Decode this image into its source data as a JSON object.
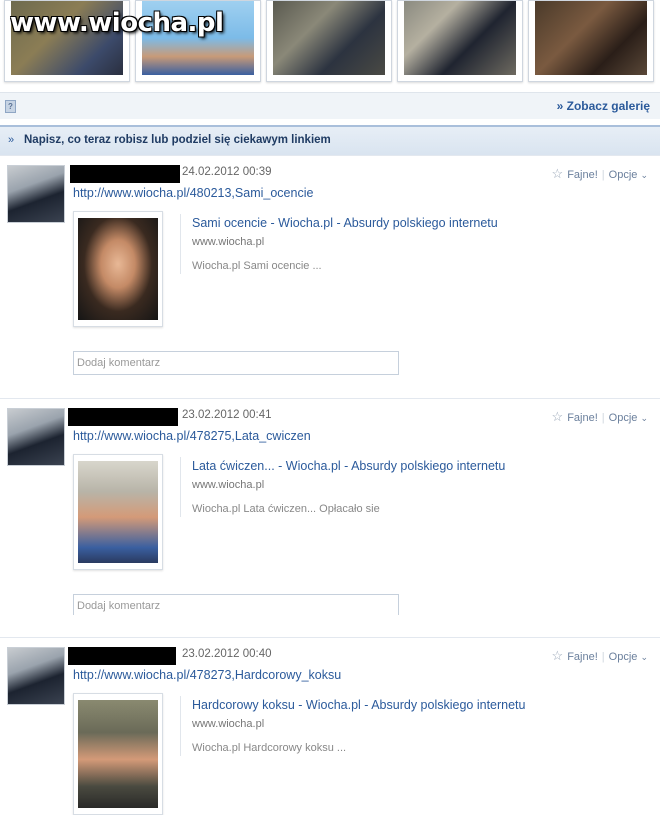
{
  "watermark": "www.wiocha.pl",
  "gallery": {
    "icon": "gallery-icon",
    "link_label": "» Zobacz galerię"
  },
  "status_prompt": {
    "arrow": "»",
    "text": "Napisz, co teraz robisz lub podziel się ciekawym linkiem"
  },
  "actions": {
    "like": "Fajne!",
    "options": "Opcje",
    "star_icon": "☆",
    "chevron_icon": "⌄"
  },
  "posts": [
    {
      "date": "24.02.2012 00:39",
      "url": "http://www.wiocha.pl/480213,Sami_ocencie",
      "link_title": "Sami ocencie - Wiocha.pl - Absurdy polskiego internetu",
      "link_domain": "www.wiocha.pl",
      "link_desc": "Wiocha.pl Sami ocencie ...",
      "comment_placeholder": "Dodaj komentarz"
    },
    {
      "date": "23.02.2012 00:41",
      "url": "http://www.wiocha.pl/478275,Lata_cwiczen",
      "link_title": "Lata ćwiczen... - Wiocha.pl - Absurdy polskiego internetu",
      "link_domain": "www.wiocha.pl",
      "link_desc": "Wiocha.pl Lata ćwiczen... Opłacało sie",
      "comment_placeholder": "Dodaj komentarz"
    },
    {
      "date": "23.02.2012 00:40",
      "url": "http://www.wiocha.pl/478273,Hardcorowy_koksu",
      "link_title": "Hardcorowy koksu - Wiocha.pl - Absurdy polskiego internetu",
      "link_domain": "www.wiocha.pl",
      "link_desc": "Wiocha.pl Hardcorowy koksu ..."
    }
  ]
}
